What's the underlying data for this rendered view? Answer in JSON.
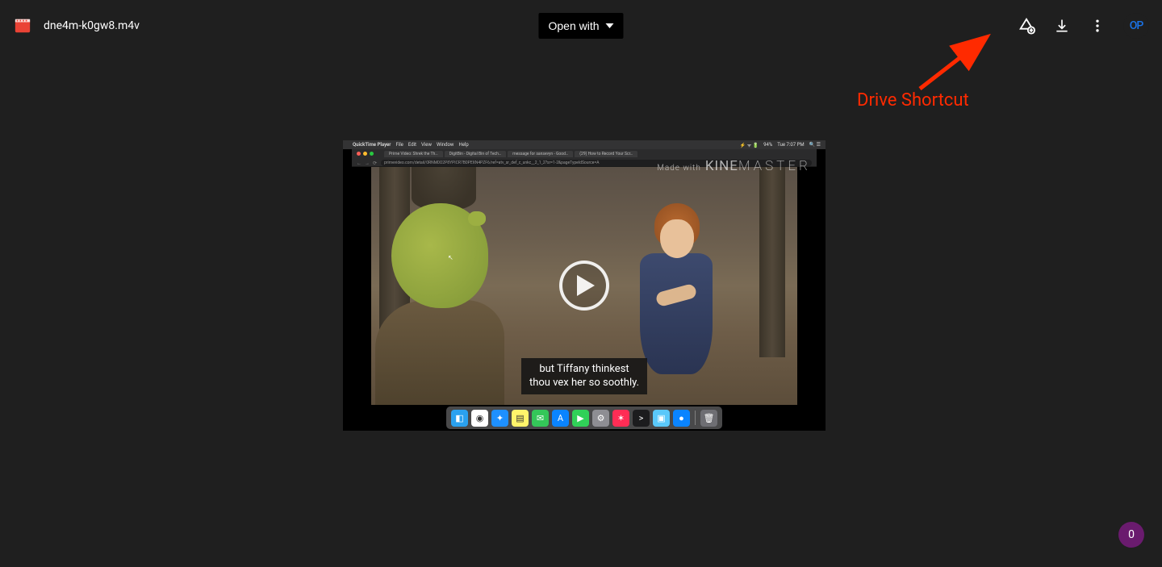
{
  "header": {
    "filename": "dne4m-k0gw8.m4v",
    "open_with_label": "Open with",
    "avatar_initials": "OP"
  },
  "annotation": {
    "label": "Drive Shortcut"
  },
  "video": {
    "mac_menu": {
      "apple": "",
      "app": "QuickTime Player",
      "items": [
        "File",
        "Edit",
        "View",
        "Window",
        "Help"
      ],
      "right": [
        "94%",
        "Tue 7:07 PM"
      ]
    },
    "browser": {
      "tabs": [
        "Prime Video: Shrek the Th…",
        "DigitBin - Digital Bin of Tech…",
        "message for sansevyn - Good…",
        "(29) How to Record Your Scr…"
      ],
      "url": "primevideo.com/detail/0RNM0O2P8YPICR7B0PEXN4PZF6/ref=atv_sr_def_c_unkc__2_1_2?sr=1-2&pageTypeIdSource=A"
    },
    "watermark_prefix": "Made with",
    "watermark_brand_a": "KINE",
    "watermark_brand_b": "MASTER",
    "caption_line1": "but Tiffany thinkest",
    "caption_line2": "thou vex her so soothly.",
    "dock_icons": [
      {
        "name": "finder",
        "bg": "#2aa1ef",
        "glyph": "◧"
      },
      {
        "name": "chrome",
        "bg": "#ffffff",
        "glyph": "◉"
      },
      {
        "name": "safari",
        "bg": "#1e90ff",
        "glyph": "✦"
      },
      {
        "name": "notes",
        "bg": "#fff46b",
        "glyph": "▤"
      },
      {
        "name": "messages",
        "bg": "#34c759",
        "glyph": "✉"
      },
      {
        "name": "appstore",
        "bg": "#0a84ff",
        "glyph": "A"
      },
      {
        "name": "facetime",
        "bg": "#30d158",
        "glyph": "▶"
      },
      {
        "name": "settings",
        "bg": "#8e8e93",
        "glyph": "⚙"
      },
      {
        "name": "lips",
        "bg": "#ff2d55",
        "glyph": "✶"
      },
      {
        "name": "terminal",
        "bg": "#1c1c1e",
        "glyph": ">"
      },
      {
        "name": "preview",
        "bg": "#5ac8fa",
        "glyph": "▣"
      },
      {
        "name": "globe",
        "bg": "#0a84ff",
        "glyph": "●"
      },
      {
        "name": "trash",
        "bg": "#6e6e73",
        "glyph": "🗑"
      }
    ]
  },
  "fab": {
    "label": "0"
  }
}
